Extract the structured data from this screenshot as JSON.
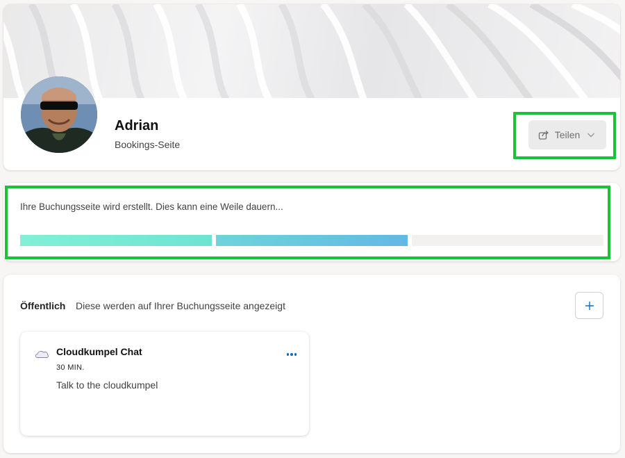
{
  "profile": {
    "name": "Adrian",
    "subtitle": "Bookings-Seite",
    "share_label": "Teilen"
  },
  "progress": {
    "message": "Ihre Buchungsseite wird erstellt. Dies kann eine Weile dauern...",
    "segments_total": 3,
    "segments_completed": 2
  },
  "public_section": {
    "title": "Öffentlich",
    "description": "Diese werden auf Ihrer Buchungsseite angezeigt",
    "add_icon": "plus-icon"
  },
  "services": [
    {
      "name": "Cloudkumpel Chat",
      "duration": "30 MIN.",
      "description": "Talk to the cloudkumpel",
      "icon": "cloud-icon",
      "menu_icon": "more-options-icon"
    }
  ],
  "colors": {
    "highlight": "#19c33a",
    "progress_start": "#82f0d6",
    "progress_end": "#63b8e6",
    "accent": "#0f6cbd"
  }
}
